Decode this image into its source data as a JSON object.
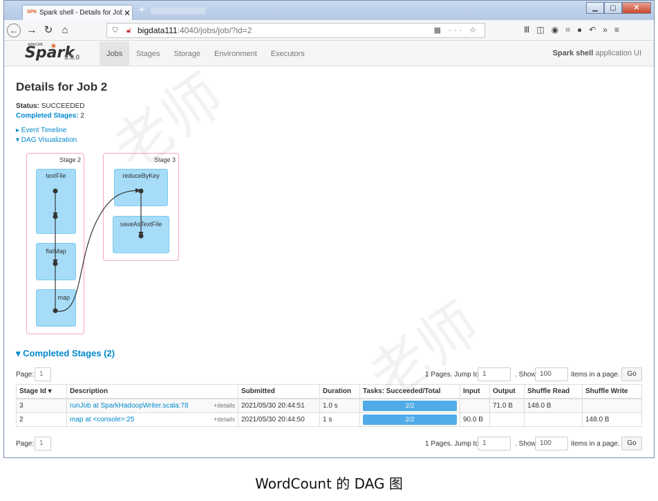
{
  "browser": {
    "tab_title": "Spark shell - Details for Job",
    "favicon_text": "SPK",
    "url_host": "bigdata111",
    "url_path": ":4040/jobs/job/?id=2",
    "toolbar_glyphs": "☰ ⊞ ☆"
  },
  "header": {
    "logo": "Spark",
    "logo_super": "APACHE",
    "version": "3.0.0",
    "menu": [
      "Jobs",
      "Stages",
      "Storage",
      "Environment",
      "Executors"
    ],
    "active_menu": "Jobs",
    "app_name": "Spark shell",
    "app_suffix": "application UI"
  },
  "page": {
    "title": "Details for Job 2",
    "status_label": "Status:",
    "status_value": "SUCCEEDED",
    "completed_label": "Completed Stages:",
    "completed_value": "2",
    "event_timeline": "▸ Event Timeline",
    "dag_visualization": "▾ DAG Visualization"
  },
  "dag": {
    "stages": [
      {
        "label": "Stage 2",
        "rdds": [
          "textFile",
          "flatMap",
          "map"
        ]
      },
      {
        "label": "Stage 3",
        "rdds": [
          "reduceByKey",
          "saveAsTextFile"
        ]
      }
    ]
  },
  "completed_stages": {
    "title": "▾ Completed Stages (2)",
    "pager": {
      "page_label": "Page:",
      "page_value": "1",
      "pages_text": "1 Pages. Jump to",
      "jump_value": "1",
      "show_text": ". Show",
      "show_value": "100",
      "items_text": "items in a page.",
      "go_label": "Go"
    },
    "columns": [
      "Stage Id ▾",
      "Description",
      "Submitted",
      "Duration",
      "Tasks: Succeeded/Total",
      "Input",
      "Output",
      "Shuffle Read",
      "Shuffle Write"
    ],
    "rows": [
      {
        "id": "3",
        "desc": "runJob at SparkHadoopWriter.scala:78",
        "details": "+details",
        "submitted": "2021/05/30 20:44:51",
        "duration": "1.0 s",
        "tasks": "2/2",
        "tasks_fraction": 1.0,
        "input": "",
        "output": "71.0 B",
        "shuffle_read": "148.0 B",
        "shuffle_write": ""
      },
      {
        "id": "2",
        "desc": "map at <console>:25",
        "details": "+details",
        "submitted": "2021/05/30 20:44:50",
        "duration": "1 s",
        "tasks": "2/2",
        "tasks_fraction": 1.0,
        "input": "90.0 B",
        "output": "",
        "shuffle_read": "",
        "shuffle_write": "148.0 B"
      }
    ]
  },
  "caption": "WordCount 的 DAG 图",
  "watermark": "老师",
  "colors": {
    "spark_blue": "#0088cc",
    "rdd_fill": "#a6dcf7",
    "stage_border": "#f5a9b8",
    "progress": "#3ea3e6"
  }
}
